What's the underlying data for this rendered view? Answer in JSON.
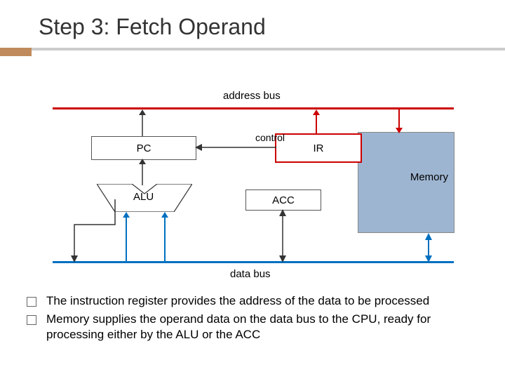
{
  "title": "Step 3: Fetch Operand",
  "bus": {
    "address": "address bus",
    "data": "data bus"
  },
  "labels": {
    "pc": "PC",
    "ir": "IR",
    "alu": "ALU",
    "acc": "ACC",
    "memory": "Memory",
    "control": "control"
  },
  "bullets": [
    "The instruction register provides the address of the data to be processed",
    "Memory supplies the operand data on the data bus to the CPU, ready for processing either by the ALU or the ACC"
  ],
  "colors": {
    "address_bus": "#c00",
    "data_bus": "#0070c0",
    "memory_fill": "#9db5d1",
    "accent": "#c08b5c"
  }
}
